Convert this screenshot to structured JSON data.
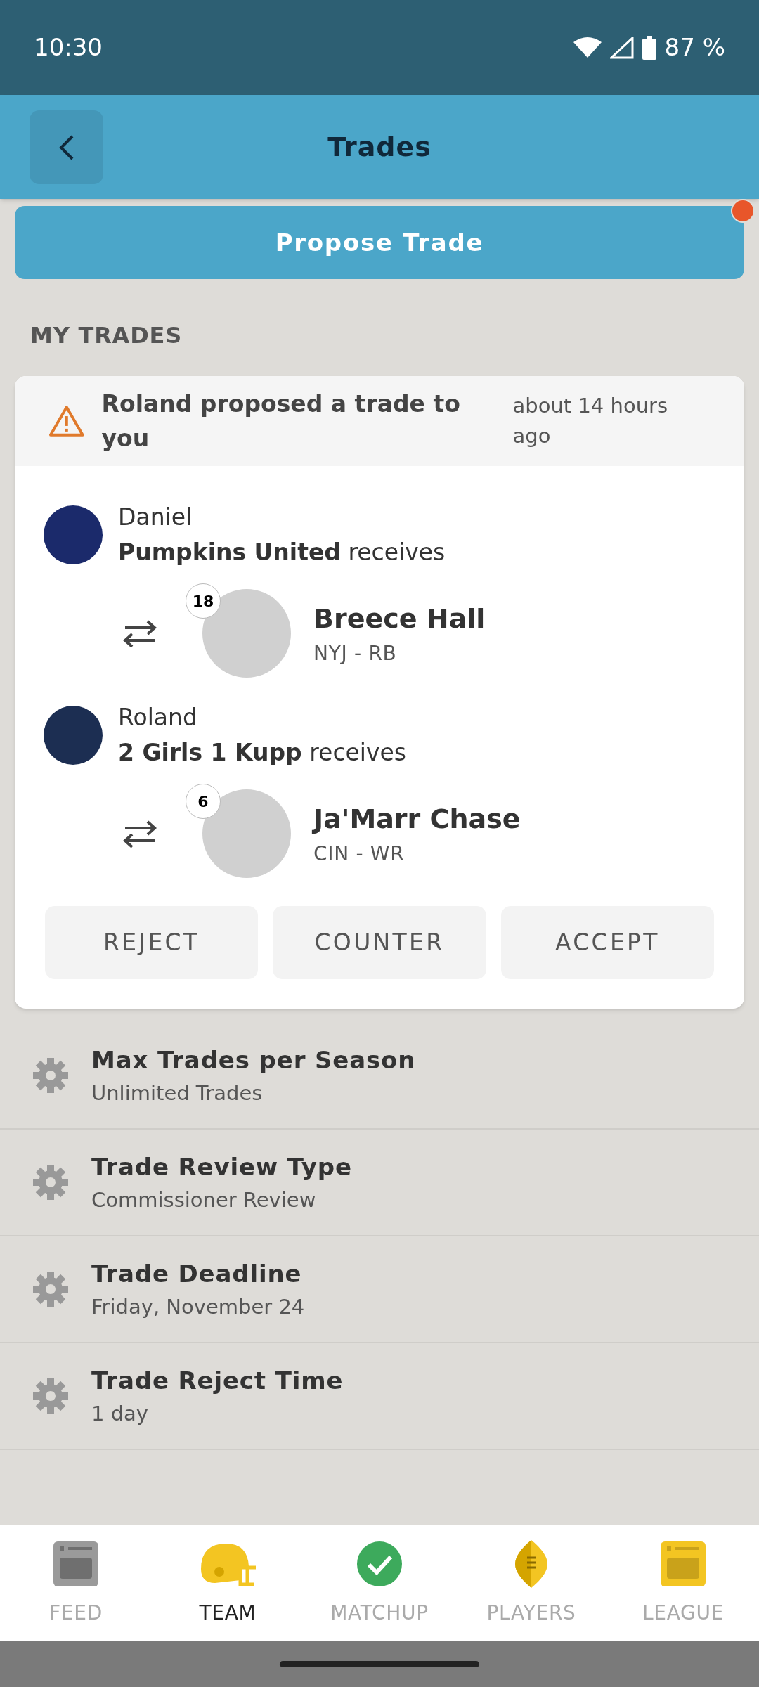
{
  "status_bar": {
    "time": "10:30",
    "battery": "87 %"
  },
  "header": {
    "title": "Trades"
  },
  "propose_button": {
    "label": "Propose Trade",
    "notification": true
  },
  "section_title": "MY TRADES",
  "trade": {
    "message": "Roland proposed a trade to you",
    "time": "about 14 hours ago",
    "sides": [
      {
        "owner": "Daniel",
        "team": "Pumpkins United",
        "suffix": "receives",
        "player": {
          "rank": "18",
          "name": "Breece Hall",
          "position": "NYJ - RB"
        }
      },
      {
        "owner": "Roland",
        "team": "2 Girls 1 Kupp",
        "suffix": "receives",
        "player": {
          "rank": "6",
          "name": "Ja'Marr Chase",
          "position": "CIN - WR"
        }
      }
    ],
    "actions": [
      "REJECT",
      "COUNTER",
      "ACCEPT"
    ]
  },
  "settings": [
    {
      "title": "Max Trades per Season",
      "value": "Unlimited Trades"
    },
    {
      "title": "Trade Review Type",
      "value": "Commissioner Review"
    },
    {
      "title": "Trade Deadline",
      "value": "Friday, November 24"
    },
    {
      "title": "Trade Reject Time",
      "value": "1 day"
    }
  ],
  "nav": [
    {
      "kind": "feed",
      "label": "FEED",
      "selected": false
    },
    {
      "kind": "team",
      "label": "TEAM",
      "selected": true
    },
    {
      "kind": "matchup",
      "label": "MATCHUP",
      "selected": false
    },
    {
      "kind": "players",
      "label": "PLAYERS",
      "selected": false
    },
    {
      "kind": "league",
      "label": "LEAGUE",
      "selected": false
    }
  ]
}
